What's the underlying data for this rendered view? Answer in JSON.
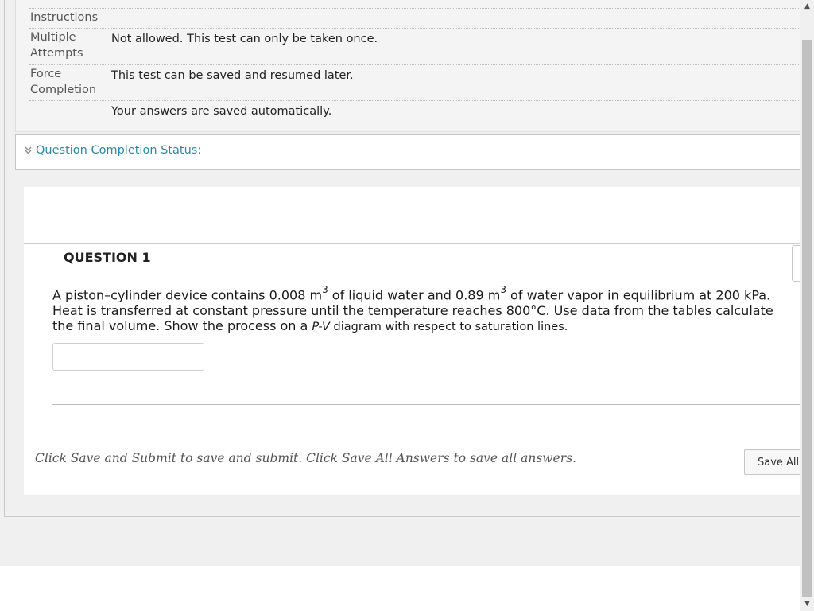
{
  "instructions_panel": {
    "rows": [
      {
        "label": "Instructions",
        "value": ""
      },
      {
        "label": "Multiple Attempts",
        "value": "Not allowed. This test can only be taken once."
      },
      {
        "label": "Force Completion",
        "value": "This test can be saved and resumed later."
      },
      {
        "label": "",
        "value": "Your answers are saved automatically."
      }
    ]
  },
  "status": {
    "label": "Question Completion Status:",
    "icon": "double-chevron-down-icon"
  },
  "question": {
    "title": "QUESTION 1",
    "text_part1": "A piston–cylinder device contains 0.008 m",
    "sup1": "3",
    "text_part2": " of liquid water and 0.89 m",
    "sup2": "3",
    "text_part3": " of water vapor in equilibrium at 200 kPa. Heat is transferred at constant pressure until the temperature reaches 800°C. Use data from the tables calculate the final volume. Show the process on a ",
    "pv_italic": "P-V",
    "text_part4": " diagram with respect to saturation lines.",
    "answer_value": ""
  },
  "footer": {
    "instruction_text": "Click Save and Submit to save and submit. Click Save All Answers to save all answers.",
    "save_all_label": "Save All Answers"
  },
  "colors": {
    "link_teal": "#2a8aa3",
    "page_background": "#f0f0f0",
    "scroll_thumb": "#c1c1c1"
  }
}
